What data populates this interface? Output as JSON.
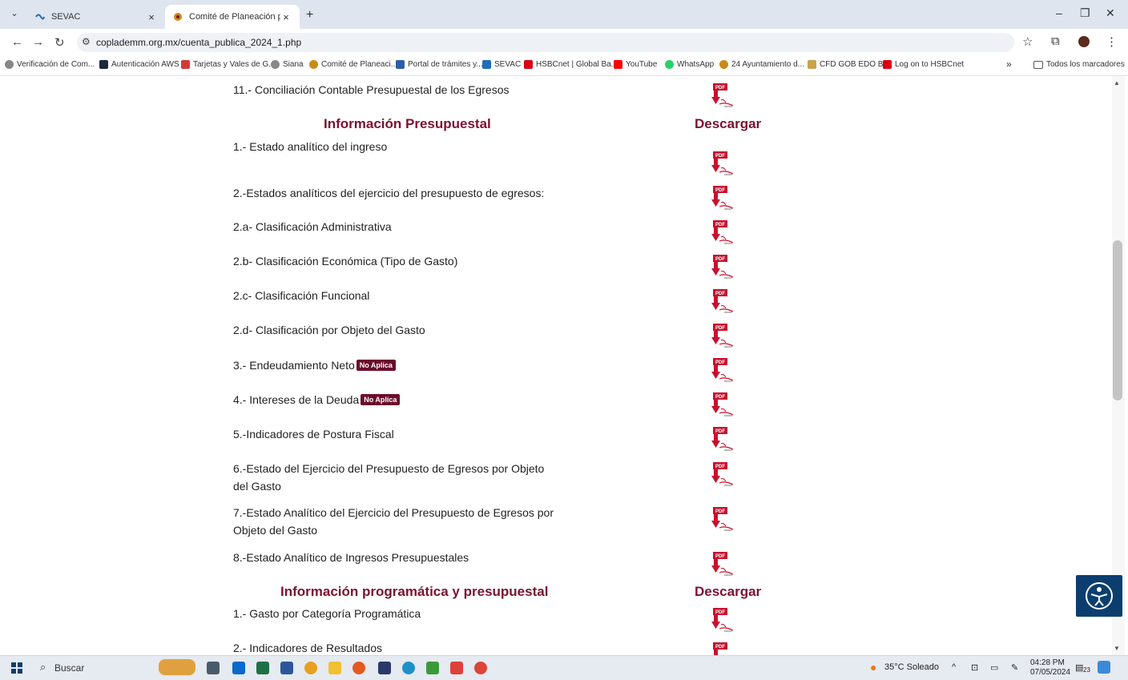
{
  "browser": {
    "tabs": [
      {
        "title": "SEVAC"
      },
      {
        "title": "Comité de Planeación para el D"
      }
    ],
    "url": "coplademm.org.mx/cuenta_publica_2024_1.php",
    "bookmarks": [
      "Verificación de Com...",
      "Autenticación AWS",
      "Tarjetas y Vales de G...",
      "Siana",
      "Comité de Planeaci...",
      "Portal de trámites y...",
      "SEVAC",
      "HSBCnet | Global Ba...",
      "YouTube",
      "WhatsApp",
      "24 Ayuntamiento d...",
      "CFD GOB EDO BC",
      "Log on to HSBCnet"
    ],
    "bookmarks_overflow": "»",
    "all_bookmarks": "Todos los marcadores"
  },
  "page": {
    "top_item": "11.- Conciliación Contable Presupuestal de los Egresos",
    "section1": {
      "title": "Información Presupuestal",
      "download": "Descargar"
    },
    "items": [
      {
        "label": "1.- Estado analítico del ingreso",
        "badge": ""
      },
      {
        "label": "2.-Estados analíticos del ejercicio del presupuesto de egresos:",
        "badge": ""
      },
      {
        "label": "2.a- Clasificación Administrativa",
        "badge": ""
      },
      {
        "label": "2.b- Clasificación Económica (Tipo de Gasto)",
        "badge": ""
      },
      {
        "label": "2.c- Clasificación Funcional",
        "badge": ""
      },
      {
        "label": "2.d- Clasificación por Objeto del Gasto",
        "badge": ""
      },
      {
        "label": "3.- Endeudamiento Neto",
        "badge": "No Aplica"
      },
      {
        "label": "4.- Intereses de la Deuda",
        "badge": "No Aplica"
      },
      {
        "label": "5.-Indicadores de Postura Fiscal",
        "badge": ""
      },
      {
        "label": "6.-Estado del Ejercicio del Presupuesto de Egresos por Objeto del Gasto",
        "badge": ""
      },
      {
        "label": "7.-Estado Analítico del Ejercicio del Presupuesto de Egresos por Objeto del Gasto",
        "badge": ""
      },
      {
        "label": "8.-Estado Analítico de Ingresos Presupuestales",
        "badge": ""
      }
    ],
    "section2": {
      "title": "Información programática y presupuestal",
      "download": "Descargar"
    },
    "items2": [
      {
        "label": "1.- Gasto por Categoría Programática"
      },
      {
        "label": "2.- Indicadores de Resultados"
      }
    ],
    "pdf_icon_label": "PDF",
    "pdf_icon_brand": "Adobe"
  },
  "taskbar": {
    "search": "Buscar",
    "weather": "35°C  Soleado",
    "time": "04:28 PM",
    "date": "07/05/2024",
    "notifications": "23"
  },
  "colors": {
    "accent": "#7b1230",
    "badge": "#6b0d2b",
    "taskbar": "#e6eaf1"
  }
}
